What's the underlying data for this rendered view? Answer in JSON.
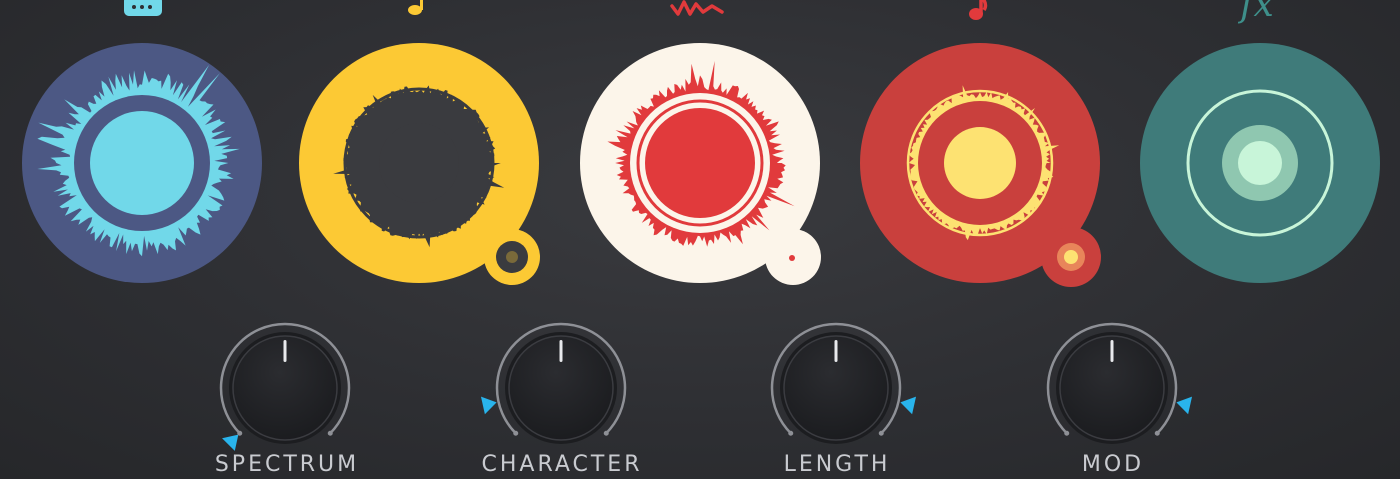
{
  "colors": {
    "background": "#2f3034",
    "blue": "#4c5884",
    "cyan": "#71d8e9",
    "yellow": "#fcc934",
    "dark": "#3a3b3f",
    "cream": "#fcf5ea",
    "red": "#e13a3c",
    "crimson": "#c9403d",
    "pale_yellow": "#fde272",
    "teal": "#3f7b7a",
    "mint": "#c8f5d9",
    "indicator": "#29b4ec"
  },
  "modules": [
    {
      "name": "instrument-module",
      "icon": "guitar-amp-icon"
    },
    {
      "name": "notes-module",
      "icon": "music-note-icon"
    },
    {
      "name": "noise-module",
      "icon": "signature-icon"
    },
    {
      "name": "pitch-module",
      "icon": "music-note-icon"
    },
    {
      "name": "fx-module",
      "icon": "fx-icon",
      "icon_text": "fx"
    }
  ],
  "knobs": [
    {
      "label": "SPECTRUM",
      "value": 0.0
    },
    {
      "label": "CHARACTER",
      "value": 0.12
    },
    {
      "label": "LENGTH",
      "value": 0.88
    },
    {
      "label": "MOD",
      "value": 0.88
    }
  ]
}
